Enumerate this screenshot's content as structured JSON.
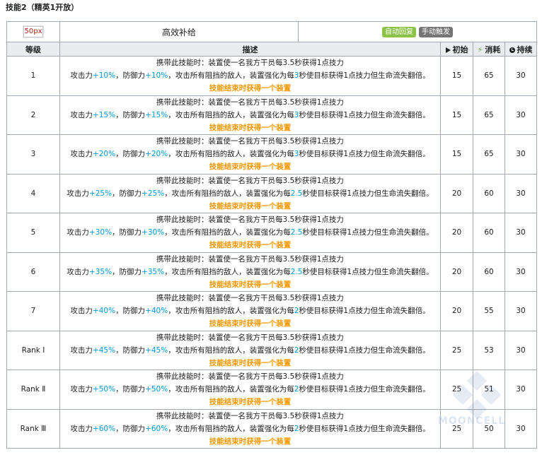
{
  "section_title": "技能2（精英1开放）",
  "skill": {
    "icon_alt": "50px",
    "name": "高效补给",
    "tags": [
      "自动回复",
      "手动触发"
    ]
  },
  "columns": {
    "level": "等级",
    "description": "描述",
    "initial": "初始",
    "cost": "消耗",
    "duration": "持续"
  },
  "rows": [
    {
      "level": "1",
      "l1": "携带此技能时：装置使一名我方干员每3.5秒获得1点技力",
      "a_pre": "攻击力",
      "atk": "+10%",
      "d_pre": "，防御力",
      "def": "+10%",
      "mid": "，攻击所有阻挡的敌人，装置强化为每",
      "sec": "3",
      "tail": "秒使目标获得1点技力但生命流失翻倍。",
      "l3": "技能结束时获得一个装置",
      "initial": "15",
      "cost": "65",
      "duration": "30"
    },
    {
      "level": "2",
      "l1": "携带此技能时：装置使一名我方干员每3.5秒获得1点技力",
      "a_pre": "攻击力",
      "atk": "+15%",
      "d_pre": "，防御力",
      "def": "+15%",
      "mid": "，攻击所有阻挡的敌人，装置强化为每",
      "sec": "3",
      "tail": "秒使目标获得1点技力但生命流失翻倍。",
      "l3": "技能结束时获得一个装置",
      "initial": "15",
      "cost": "65",
      "duration": "30"
    },
    {
      "level": "3",
      "l1": "携带此技能时：装置使一名我方干员每3.5秒获得1点技力",
      "a_pre": "攻击力",
      "atk": "+20%",
      "d_pre": "，防御力",
      "def": "+20%",
      "mid": "，攻击所有阻挡的敌人，装置强化为每",
      "sec": "3",
      "tail": "秒使目标获得1点技力但生命流失翻倍。",
      "l3": "技能结束时获得一个装置",
      "initial": "15",
      "cost": "65",
      "duration": "30"
    },
    {
      "level": "4",
      "l1": "携带此技能时：装置使一名我方干员每3.5秒获得1点技力",
      "a_pre": "攻击力",
      "atk": "+25%",
      "d_pre": "，防御力",
      "def": "+25%",
      "mid": "，攻击所有阻挡的敌人，装置强化为每",
      "sec": "2.5",
      "tail": "秒使目标获得1点技力但生命流失翻倍。",
      "l3": "技能结束时获得一个装置",
      "initial": "20",
      "cost": "60",
      "duration": "30"
    },
    {
      "level": "5",
      "l1": "携带此技能时：装置使一名我方干员每3.5秒获得1点技力",
      "a_pre": "攻击力",
      "atk": "+30%",
      "d_pre": "，防御力",
      "def": "+30%",
      "mid": "，攻击所有阻挡的敌人，装置强化为每",
      "sec": "2.5",
      "tail": "秒使目标获得1点技力但生命流失翻倍。",
      "l3": "技能结束时获得一个装置",
      "initial": "20",
      "cost": "60",
      "duration": "30"
    },
    {
      "level": "6",
      "l1": "携带此技能时：装置使一名我方干员每3.5秒获得1点技力",
      "a_pre": "攻击力",
      "atk": "+35%",
      "d_pre": "，防御力",
      "def": "+35%",
      "mid": "，攻击所有阻挡的敌人，装置强化为每",
      "sec": "2.5",
      "tail": "秒使目标获得1点技力但生命流失翻倍。",
      "l3": "技能结束时获得一个装置",
      "initial": "20",
      "cost": "60",
      "duration": "30"
    },
    {
      "level": "7",
      "l1": "携带此技能时：装置使一名我方干员每3.5秒获得1点技力",
      "a_pre": "攻击力",
      "atk": "+40%",
      "d_pre": "，防御力",
      "def": "+40%",
      "mid": "，攻击所有阻挡的敌人，装置强化为每",
      "sec": "2",
      "tail": "秒使目标获得1点技力但生命流失翻倍。",
      "l3": "技能结束时获得一个装置",
      "initial": "20",
      "cost": "55",
      "duration": "30"
    },
    {
      "level": "Rank Ⅰ",
      "l1": "携带此技能时：装置使一名我方干员每3.5秒获得1点技力",
      "a_pre": "攻击力",
      "atk": "+45%",
      "d_pre": "，防御力",
      "def": "+45%",
      "mid": "，攻击所有阻挡的敌人，装置强化为每",
      "sec": "2",
      "tail": "秒使目标获得1点技力但生命流失翻倍。",
      "l3": "技能结束时获得一个装置",
      "initial": "25",
      "cost": "53",
      "duration": "30"
    },
    {
      "level": "Rank Ⅱ",
      "l1": "携带此技能时：装置使一名我方干员每3.5秒获得1点技力",
      "a_pre": "攻击力",
      "atk": "+50%",
      "d_pre": "，防御力",
      "def": "+50%",
      "mid": "，攻击所有阻挡的敌人，装置强化为每",
      "sec": "2",
      "tail": "秒使目标获得1点技力但生命流失翻倍。",
      "l3": "技能结束时获得一个装置",
      "initial": "25",
      "cost": "51",
      "duration": "30"
    },
    {
      "level": "Rank Ⅲ",
      "l1": "携带此技能时：装置使一名我方干员每3.5秒获得1点技力",
      "a_pre": "攻击力",
      "atk": "+60%",
      "d_pre": "，防御力",
      "def": "+60%",
      "mid": "，攻击所有阻挡的敌人，装置强化为每",
      "sec": "2",
      "tail": "秒使目标获得1点技力但生命流失翻倍。",
      "l3": "技能结束时获得一个装置",
      "initial": "25",
      "cost": "50",
      "duration": "30"
    }
  ],
  "watermark_text": "MOONCELL",
  "colors": {
    "highlight_blue": "#0098dc",
    "highlight_orange": "#f49800",
    "tag_auto": "#8bc34a",
    "tag_manual": "#757575",
    "header_bg": "#eaecf0"
  }
}
